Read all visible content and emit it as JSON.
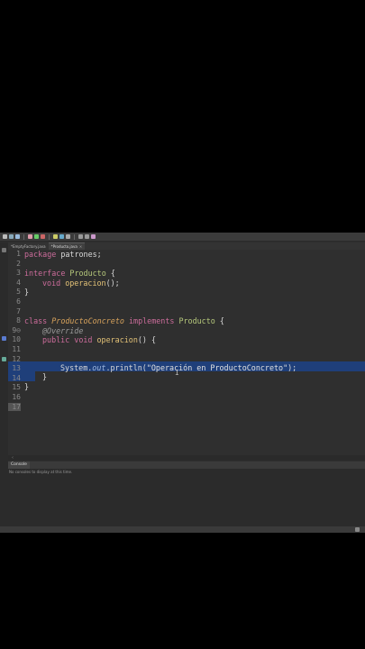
{
  "tabs": [
    {
      "label": "*EmptyFactory.java",
      "active": false
    },
    {
      "label": "*Producto.java",
      "active": true
    }
  ],
  "gutter": {
    "lines": [
      "1",
      "2",
      "3",
      "4",
      "5",
      "6",
      "7",
      "8",
      "9⊖",
      "10",
      "11",
      "12",
      "13",
      "14",
      "15",
      "16",
      "17"
    ]
  },
  "code": {
    "l1_kw": "package",
    "l1_rest": " patrones;",
    "l3_kw": "interface",
    "l3_name": " Producto",
    "l3_rest": " {",
    "l4_kw": "void",
    "l4_meth": " operacion",
    "l4_rest": "();",
    "l5": "}",
    "l8_kw1": "class",
    "l8_name": " ProductoConcreto",
    "l8_kw2": " implements",
    "l8_ifc": " Producto",
    "l8_rest": " {",
    "l9_ann": "@Override",
    "l10_kw": "public void",
    "l10_meth": " operacion",
    "l10_rest": "() {",
    "l11_pre": "System.",
    "l11_out": "out",
    "l11_mid": ".println(",
    "l11_str": "\"Operación en ProductoConcreto\"",
    "l11_end": ");",
    "l12": "}",
    "l13": "}"
  },
  "console": {
    "tab_label": "Console",
    "message": "No consoles to display at this time."
  },
  "colors": {
    "selection": "#1f3f7a",
    "keyword": "#cc6c9b",
    "type": "#b5c77b",
    "string": "#e1e1e1"
  }
}
